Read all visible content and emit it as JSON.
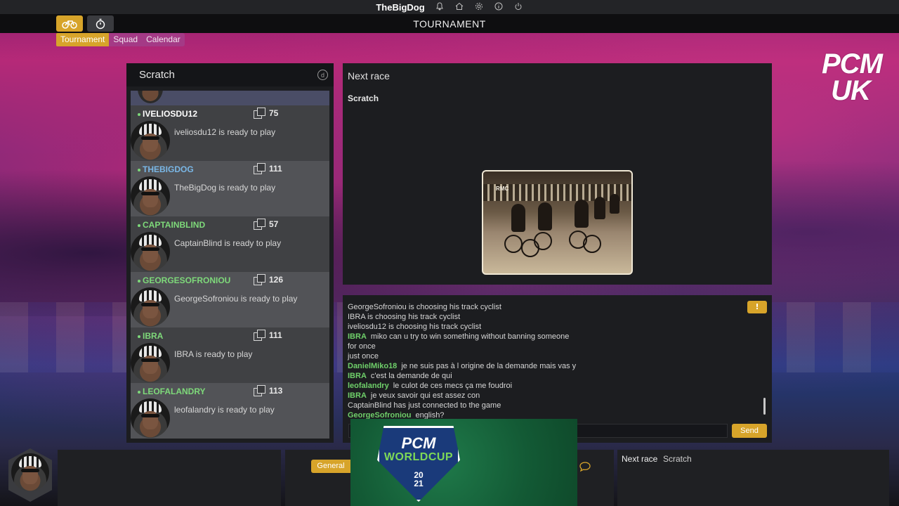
{
  "topbar": {
    "username": "TheBigDog",
    "icons": [
      "bell-icon",
      "home-icon",
      "settings-icon",
      "info-icon",
      "power-icon"
    ]
  },
  "title": "TOURNAMENT",
  "tabs": [
    {
      "label": "Tournament",
      "active": true
    },
    {
      "label": "Squad",
      "active": false
    },
    {
      "label": "Calendar",
      "active": false
    }
  ],
  "watermark": "PCM UK",
  "players_panel": {
    "title": "Scratch",
    "players": [
      {
        "name": "IVELIOSDU12",
        "rank": "75",
        "status": "iveliosdu12 is ready to play",
        "name_color": "#ffffff"
      },
      {
        "name": "THEBIGDOG",
        "rank": "111",
        "status": "TheBigDog is ready to play",
        "name_color": "#7ab7e6"
      },
      {
        "name": "CAPTAINBLIND",
        "rank": "57",
        "status": "CaptainBlind is ready to play",
        "name_color": "#7ed97a"
      },
      {
        "name": "GEORGESOFRONIOU",
        "rank": "126",
        "status": "GeorgeSofroniou is ready to play",
        "name_color": "#7ed97a"
      },
      {
        "name": "IBRA",
        "rank": "111",
        "status": "IBRA is ready to play",
        "name_color": "#7ed97a"
      },
      {
        "name": "LEOFALANDRY",
        "rank": "113",
        "status": "leofalandry is ready to play",
        "name_color": "#7ed97a"
      }
    ]
  },
  "race_panel": {
    "title": "Next race",
    "race_name": "Scratch",
    "photo_sign": "RMC"
  },
  "chat": {
    "warn_label": "!",
    "lines": [
      {
        "who": "",
        "text": "GeorgeSofroniou is choosing his track cyclist"
      },
      {
        "who": "",
        "text": "IBRA is choosing his track cyclist"
      },
      {
        "who": "",
        "text": "iveliosdu12 is choosing his track cyclist"
      },
      {
        "who": "IBRA",
        "text": "miko can u try to win something without banning someone"
      },
      {
        "who": "",
        "text": "for once"
      },
      {
        "who": "",
        "text": "just once"
      },
      {
        "who": "DanielMiko18",
        "text": "je ne suis pas à l origine de la demande mais vas y"
      },
      {
        "who": "IBRA",
        "text": "c'est la demande de qui"
      },
      {
        "who": "leofalandry",
        "text": "le culot de ces mecs ça me foudroi"
      },
      {
        "who": "IBRA",
        "text": "je veux savoir qui est assez con"
      },
      {
        "who": "",
        "text": " CaptainBlind has just connected to the game"
      },
      {
        "who": "GeorgeSofroniou",
        "text": "english?"
      }
    ],
    "input_value": "",
    "send_label": "Send"
  },
  "bottom": {
    "general_label": "General",
    "next_race_label": "Next race",
    "next_race_value": "Scratch"
  },
  "worldcup": {
    "line1": "PCM",
    "line2": "WORLDCUP",
    "year_top": "20",
    "year_bottom": "21"
  },
  "colors": {
    "accent": "#d7a42a",
    "tab_inactive": "#a43a86",
    "chat_name": "#6fd06a"
  }
}
